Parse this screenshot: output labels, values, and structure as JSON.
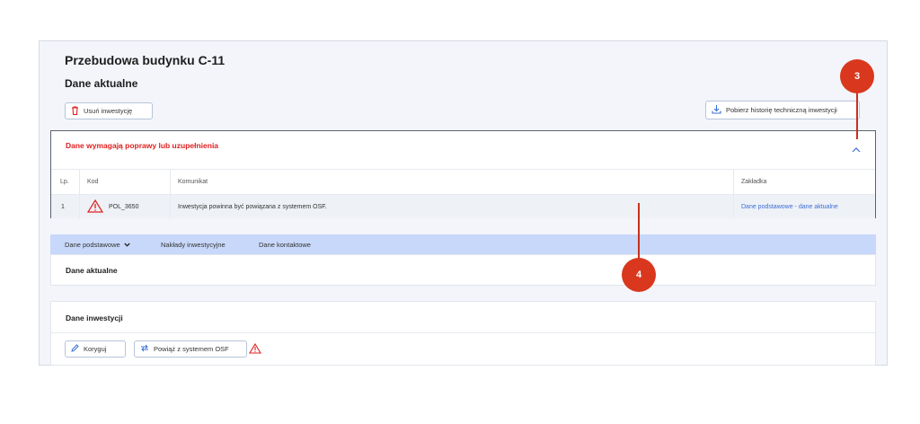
{
  "page": {
    "title": "Przebudowa budynku C-11",
    "subtitle": "Dane aktualne"
  },
  "toolbar": {
    "delete_label": "Usuń inwestycję",
    "download_label": "Pobierz historię techniczną inwestycji"
  },
  "errors_panel": {
    "title": "Dane wymagają poprawy lub uzupełnienia",
    "columns": {
      "lp": "Lp.",
      "kod": "Kod",
      "komunikat": "Komunikat",
      "zakladka": "Zakładka"
    },
    "rows": [
      {
        "lp": "1",
        "kod": "POL_3650",
        "komunikat": "Inwestycja powinna być powiązana z systemem OSF.",
        "zakladka": "Dane podstawowe - dane aktualne"
      }
    ]
  },
  "tabs": [
    {
      "label": "Dane podstawowe"
    },
    {
      "label": "Nakłady inwestycyjne"
    },
    {
      "label": "Dane kontaktowe"
    }
  ],
  "sections": {
    "current": {
      "title": "Dane aktualne"
    },
    "investment": {
      "title": "Dane inwestycji",
      "edit_label": "Koryguj",
      "link_label": "Powiąż z systemem OSF"
    }
  },
  "markers": {
    "m3": "3",
    "m4": "4"
  },
  "colors": {
    "error": "#e02020",
    "accent": "#3b6fd6",
    "tab_bar": "#c8d8fa",
    "marker": "#d9381e"
  },
  "icons": [
    "trash-icon",
    "download-icon",
    "chevron-up-icon",
    "warning-icon",
    "chevron-down-icon",
    "pencil-icon",
    "swap-icon"
  ]
}
